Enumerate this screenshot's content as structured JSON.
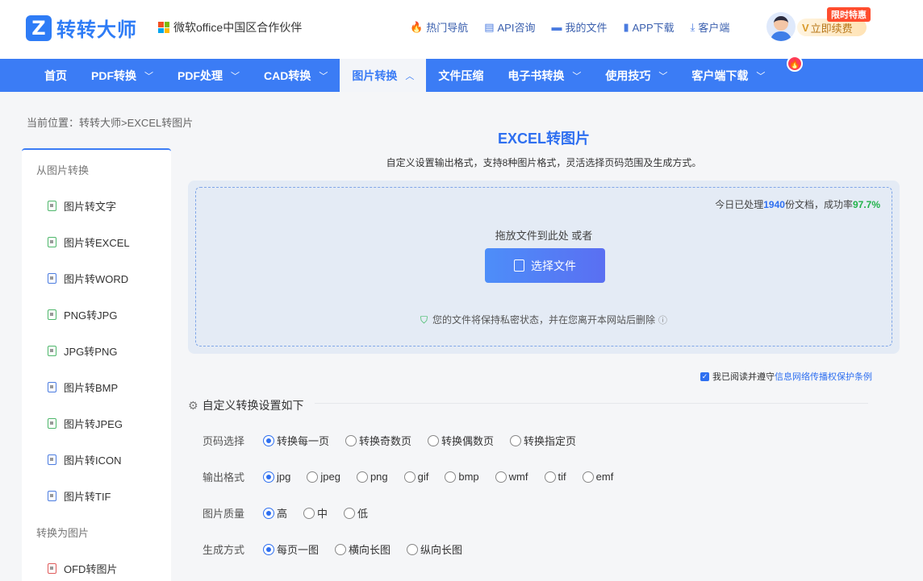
{
  "header": {
    "logo_mark": "Z",
    "logo_text": "转转大师",
    "partner_text": "微软office中国区合作伙伴",
    "top_links": [
      {
        "icon": "fire-icon",
        "glyph": "🔥",
        "label": "热门导航"
      },
      {
        "icon": "chat-icon",
        "glyph": "▤",
        "label": "API咨询"
      },
      {
        "icon": "folder-icon",
        "glyph": "▬",
        "label": "我的文件"
      },
      {
        "icon": "phone-icon",
        "glyph": "▮",
        "label": "APP下载"
      },
      {
        "icon": "download-icon",
        "glyph": "⤓",
        "label": "客户端"
      }
    ],
    "renew_label": "立即续费",
    "renew_mark": "V",
    "promo_badge": "限时特惠"
  },
  "nav": {
    "items": [
      {
        "label": "首页",
        "caret": false
      },
      {
        "label": "PDF转换",
        "caret": true
      },
      {
        "label": "PDF处理",
        "caret": true
      },
      {
        "label": "CAD转换",
        "caret": true
      },
      {
        "label": "图片转换",
        "caret": true,
        "active": true
      },
      {
        "label": "文件压缩",
        "caret": false
      },
      {
        "label": "电子书转换",
        "caret": true
      },
      {
        "label": "使用技巧",
        "caret": true
      },
      {
        "label": "客户端下载",
        "caret": true
      }
    ],
    "hot_glyph": "🔥"
  },
  "breadcrumb": "当前位置：转转大师>EXCEL转图片",
  "sidebar": {
    "group1": "从图片转换",
    "items1": [
      {
        "label": "图片转文字",
        "color": "green"
      },
      {
        "label": "图片转EXCEL",
        "color": "green"
      },
      {
        "label": "图片转WORD",
        "color": "blue"
      },
      {
        "label": "PNG转JPG",
        "color": "green"
      },
      {
        "label": "JPG转PNG",
        "color": "green"
      },
      {
        "label": "图片转BMP",
        "color": "blue"
      },
      {
        "label": "图片转JPEG",
        "color": "green"
      },
      {
        "label": "图片转ICON",
        "color": "blue"
      },
      {
        "label": "图片转TIF",
        "color": "blue"
      }
    ],
    "group2": "转换为图片",
    "items2": [
      {
        "label": "OFD转图片",
        "color": "red"
      }
    ]
  },
  "main": {
    "title": "EXCEL转图片",
    "subtitle": "自定义设置输出格式，支持8种图片格式，灵活选择页码范围及生成方式。",
    "stats_prefix": "今日已处理",
    "stats_count": "1940",
    "stats_mid": "份文档，成功率",
    "stats_rate": "97.7%",
    "drop_text": "拖放文件到此处 或者",
    "select_button": "选择文件",
    "privacy_text": "您的文件将保持私密状态，并在您离开本网站后删除",
    "agree_prefix": "我已阅读并遵守",
    "agree_link": "信息网络传播权保护条例",
    "settings_title": "自定义转换设置如下"
  },
  "options": [
    {
      "label": "页码选择",
      "choices": [
        "转换每一页",
        "转换奇数页",
        "转换偶数页",
        "转换指定页"
      ],
      "selected": 0
    },
    {
      "label": "输出格式",
      "choices": [
        "jpg",
        "jpeg",
        "png",
        "gif",
        "bmp",
        "wmf",
        "tif",
        "emf"
      ],
      "selected": 0
    },
    {
      "label": "图片质量",
      "choices": [
        "高",
        "中",
        "低"
      ],
      "selected": 0
    },
    {
      "label": "生成方式",
      "choices": [
        "每页一图",
        "横向长图",
        "纵向长图"
      ],
      "selected": 0
    }
  ],
  "colors": {
    "brand": "#3b7cf5",
    "accent_blue": "#2e6ff0",
    "success_green": "#21b24a",
    "promo_red": "#ff4d2e"
  }
}
